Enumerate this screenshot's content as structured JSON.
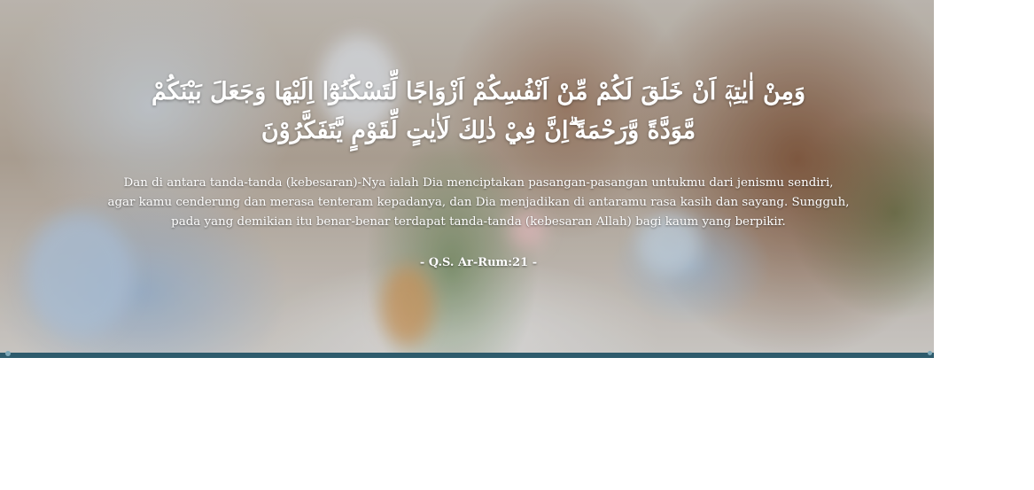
{
  "hero": {
    "arabic_verse": "وَمِنْ اٰيٰتِهٖٓ اَنْ خَلَقَ لَكُمْ مِّنْ اَنْفُسِكُمْ اَزْوَاجًا لِّتَسْكُنُوْٓا اِلَيْهَا وَجَعَلَ بَيْنَكُمْ مَّوَدَّةً وَّرَحْمَةً ۗاِنَّ فِيْ ذٰلِكَ لَاٰيٰتٍ لِّقَوْمٍ يَّتَفَكَّرُوْنَ",
    "translation_line1": "Dan di antara tanda-tanda (kebesaran)-Nya ialah Dia menciptakan pasangan-pasangan untukmu dari jenismu sendiri,",
    "translation_line2": "agar kamu cenderung dan merasa tenteram kepadanya, dan Dia menjadikan di antaramu rasa kasih dan sayang. Sungguh,",
    "translation_line3": "pada yang demikian itu benar-benar terdapat tanda-tanda (kebesaran Allah) bagi kaum yang berpikir.",
    "reference": "- Q.S. Ar-Rum:21 -"
  },
  "colors": {
    "bar": "#2e5b6c",
    "text": "#ffffff"
  }
}
